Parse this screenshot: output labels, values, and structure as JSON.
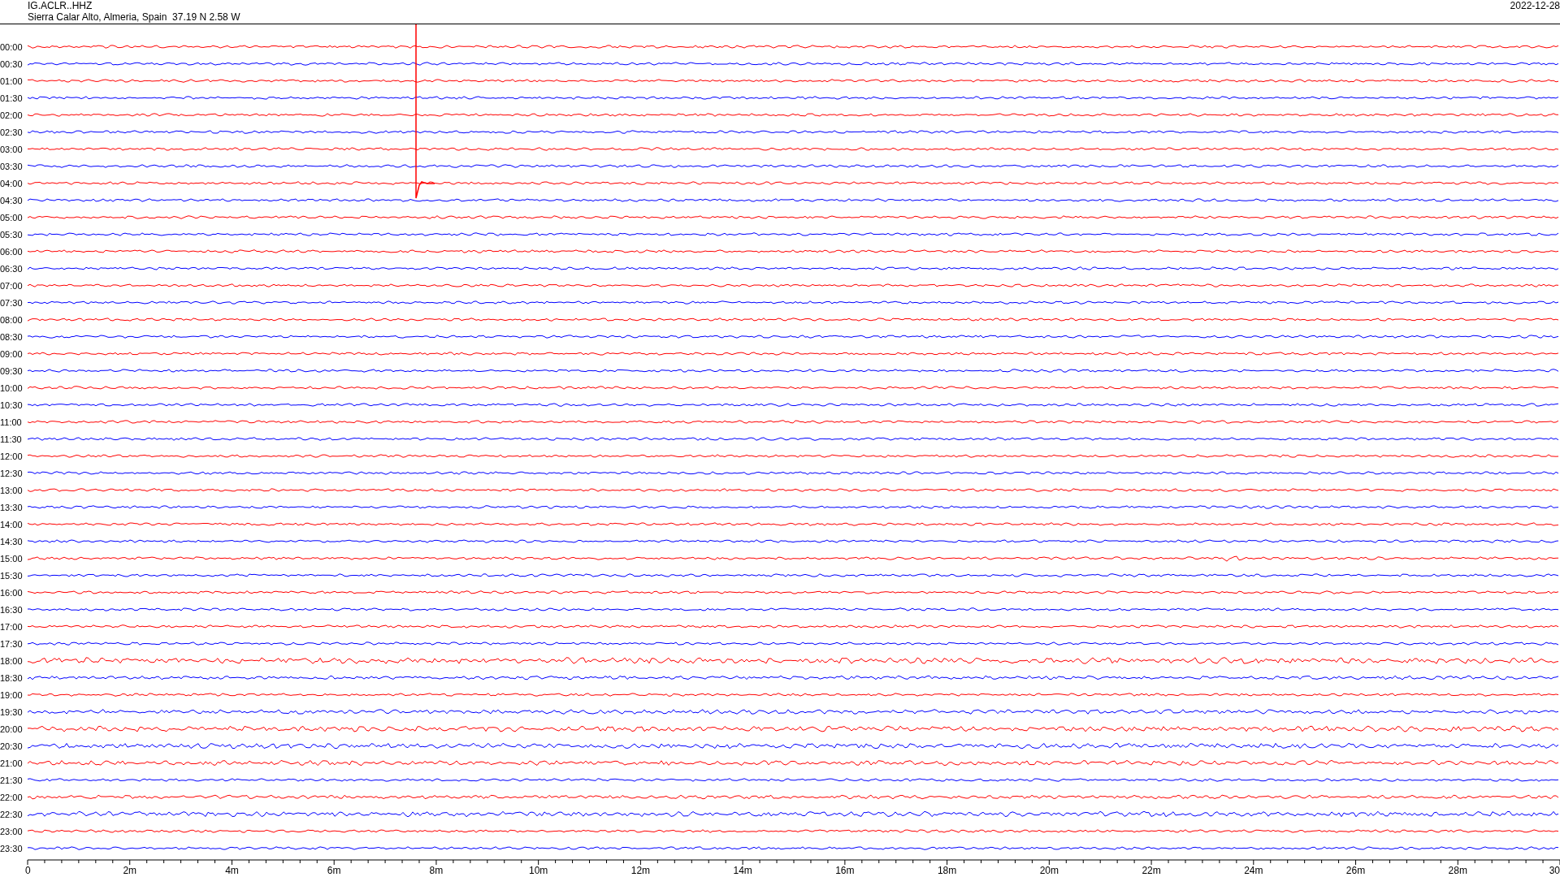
{
  "header": {
    "station": "IG.ACLR..HHZ",
    "location": "Sierra Calar Alto, Almeria, Spain  37.19 N 2.58 W",
    "date": "2022-12-28"
  },
  "traces": [
    {
      "time": "00:00",
      "color": "#ff0000"
    },
    {
      "time": "00:30",
      "color": "#0000ff"
    },
    {
      "time": "01:00",
      "color": "#ff0000"
    },
    {
      "time": "01:30",
      "color": "#0000ff"
    },
    {
      "time": "02:00",
      "color": "#ff0000"
    },
    {
      "time": "02:30",
      "color": "#0000ff"
    },
    {
      "time": "03:00",
      "color": "#ff0000"
    },
    {
      "time": "03:30",
      "color": "#0000ff"
    },
    {
      "time": "04:00",
      "color": "#ff0000"
    },
    {
      "time": "04:30",
      "color": "#0000ff"
    },
    {
      "time": "05:00",
      "color": "#ff0000"
    },
    {
      "time": "05:30",
      "color": "#0000ff"
    },
    {
      "time": "06:00",
      "color": "#ff0000"
    },
    {
      "time": "06:30",
      "color": "#0000ff"
    },
    {
      "time": "07:00",
      "color": "#ff0000"
    },
    {
      "time": "07:30",
      "color": "#0000ff"
    },
    {
      "time": "08:00",
      "color": "#ff0000"
    },
    {
      "time": "08:30",
      "color": "#0000ff"
    },
    {
      "time": "09:00",
      "color": "#ff0000"
    },
    {
      "time": "09:30",
      "color": "#0000ff"
    },
    {
      "time": "10:00",
      "color": "#ff0000"
    },
    {
      "time": "10:30",
      "color": "#0000ff"
    },
    {
      "time": "11:00",
      "color": "#ff0000"
    },
    {
      "time": "11:30",
      "color": "#0000ff"
    },
    {
      "time": "12:00",
      "color": "#ff0000"
    },
    {
      "time": "12:30",
      "color": "#0000ff"
    },
    {
      "time": "13:00",
      "color": "#ff0000"
    },
    {
      "time": "13:30",
      "color": "#0000ff"
    },
    {
      "time": "14:00",
      "color": "#ff0000"
    },
    {
      "time": "14:30",
      "color": "#0000ff"
    },
    {
      "time": "15:00",
      "color": "#ff0000"
    },
    {
      "time": "15:30",
      "color": "#0000ff"
    },
    {
      "time": "16:00",
      "color": "#ff0000"
    },
    {
      "time": "16:30",
      "color": "#0000ff"
    },
    {
      "time": "17:00",
      "color": "#ff0000"
    },
    {
      "time": "17:30",
      "color": "#0000ff"
    },
    {
      "time": "18:00",
      "color": "#ff0000"
    },
    {
      "time": "18:30",
      "color": "#0000ff"
    },
    {
      "time": "19:00",
      "color": "#ff0000"
    },
    {
      "time": "19:30",
      "color": "#0000ff"
    },
    {
      "time": "20:00",
      "color": "#ff0000"
    },
    {
      "time": "20:30",
      "color": "#0000ff"
    },
    {
      "time": "21:00",
      "color": "#ff0000"
    },
    {
      "time": "21:30",
      "color": "#0000ff"
    },
    {
      "time": "22:00",
      "color": "#ff0000"
    },
    {
      "time": "22:30",
      "color": "#0000ff"
    },
    {
      "time": "23:00",
      "color": "#ff0000"
    },
    {
      "time": "23:30",
      "color": "#0000ff"
    }
  ],
  "axis": {
    "ticks": [
      "0",
      "2m",
      "4m",
      "6m",
      "8m",
      "10m",
      "12m",
      "14m",
      "16m",
      "18m",
      "20m",
      "22m",
      "24m",
      "26m",
      "28m",
      "30"
    ]
  }
}
